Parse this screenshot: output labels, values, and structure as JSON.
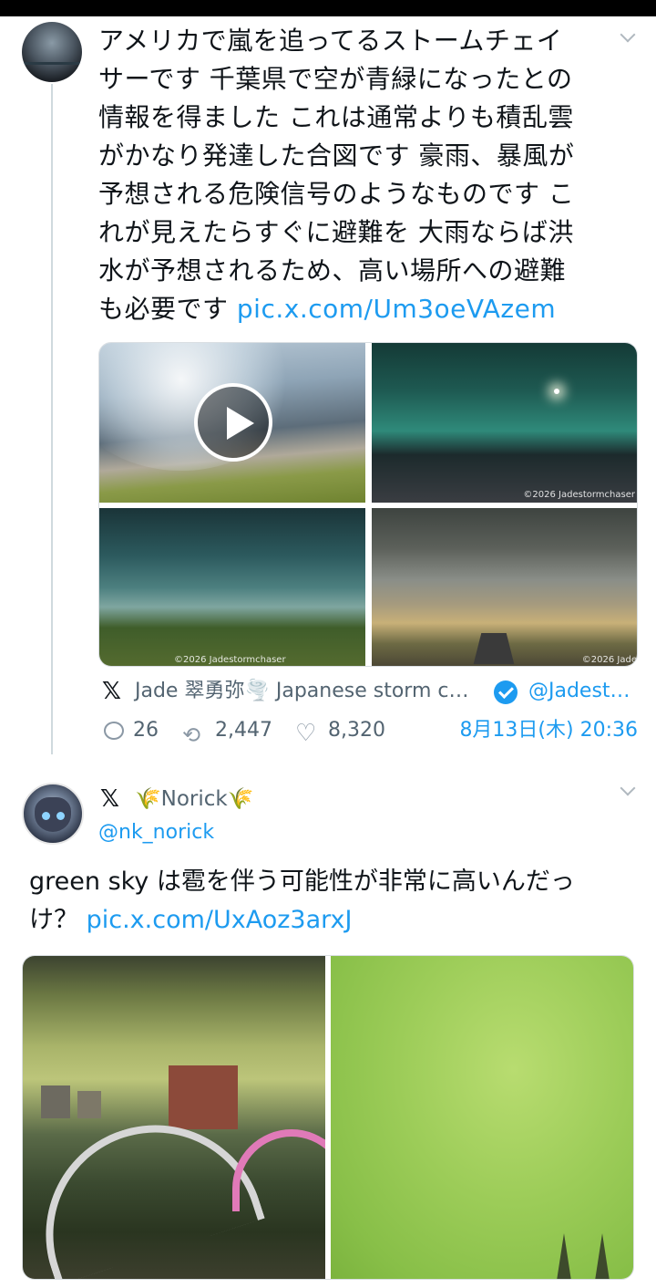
{
  "tweet1": {
    "text_lines": [
      "アメリカで嵐を追ってるストームチェイ",
      "サーです 千葉県で空が青緑になったとの",
      "情報を得ました これは通常よりも積乱雲",
      "がかなり発達した合図です 豪雨、暴風が",
      "予想される危険信号のようなものです こ",
      "れが見えたらすぐに避難を 大雨ならば洪",
      "水が予想されるため、高い場所への避難",
      "も必要です "
    ],
    "link": "pic.x.com/Um3oeVAzem",
    "watermarks": [
      "©2026 Jadestormchaser",
      "©2026 Jadestormchaser",
      "©2026 Jade"
    ],
    "source": {
      "platform_icon": "x-logo-icon",
      "display_name": "Jade 翠勇弥🌪️ Japanese storm c…",
      "handle": "@Jadest…"
    },
    "stats": {
      "replies": "26",
      "retweets": "2,447",
      "likes": "8,320",
      "date": "8月13日(木) 20:36"
    }
  },
  "tweet2": {
    "platform_icon": "x-logo-icon",
    "display_name": "🌾Norick🌾",
    "handle": "@nk_norick",
    "text_line1": "green sky は雹を伴う可能性が非常に高いんだっ",
    "text_line2_prefix": "け？ ",
    "link": "pic.x.com/UxAoz3arxJ"
  },
  "colors": {
    "link": "#1d9bf0",
    "secondary_text": "#536471",
    "thread_line": "#cfd9de"
  }
}
